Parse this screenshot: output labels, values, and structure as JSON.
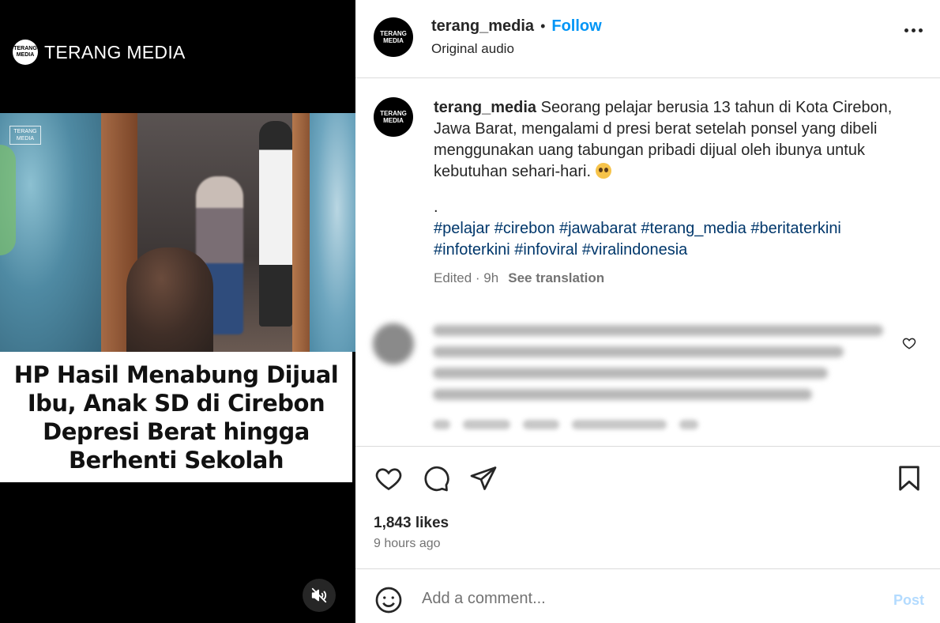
{
  "media": {
    "brand_name": "TERANG MEDIA",
    "brand_logo_text": "TERANG MEDIA",
    "watermark_text": "TERANG MEDIA",
    "headline": "HP Hasil Menabung Dijual Ibu, Anak SD di Cirebon Depresi Berat hingga Berhenti Sekolah",
    "mute_icon": "speaker-muted-icon"
  },
  "header": {
    "avatar_text": "TERANG MEDIA",
    "username": "terang_media",
    "separator": "•",
    "follow_label": "Follow",
    "subtitle": "Original audio",
    "more_icon": "more-horizontal-icon"
  },
  "caption": {
    "avatar_text": "TERANG MEDIA",
    "username": "terang_media",
    "text": " Seorang pelajar berusia 13 tahun di Kota Cirebon, Jawa Barat, mengalami d presi berat setelah ponsel yang dibeli menggunakan uang tabungan pribadi dijual oleh ibunya untuk kebutuhan sehari-hari.",
    "emoji": "pleading-face-emoji",
    "dot": ".",
    "hashtags_line1": "#pelajar #cirebon #jawabarat #terang_media #beritaterkini",
    "hashtags_line2": "#infoterkini #infoviral #viralindonesia",
    "edited": "Edited · 9h",
    "see_translation": "See translation"
  },
  "actions": {
    "like_icon": "heart-icon",
    "comment_icon": "comment-icon",
    "share_icon": "share-icon",
    "save_icon": "bookmark-icon",
    "likes": "1,843 likes",
    "time_ago": "9 hours ago"
  },
  "add_comment": {
    "emoji_icon": "smiley-icon",
    "placeholder": "Add a comment...",
    "post_label": "Post"
  }
}
